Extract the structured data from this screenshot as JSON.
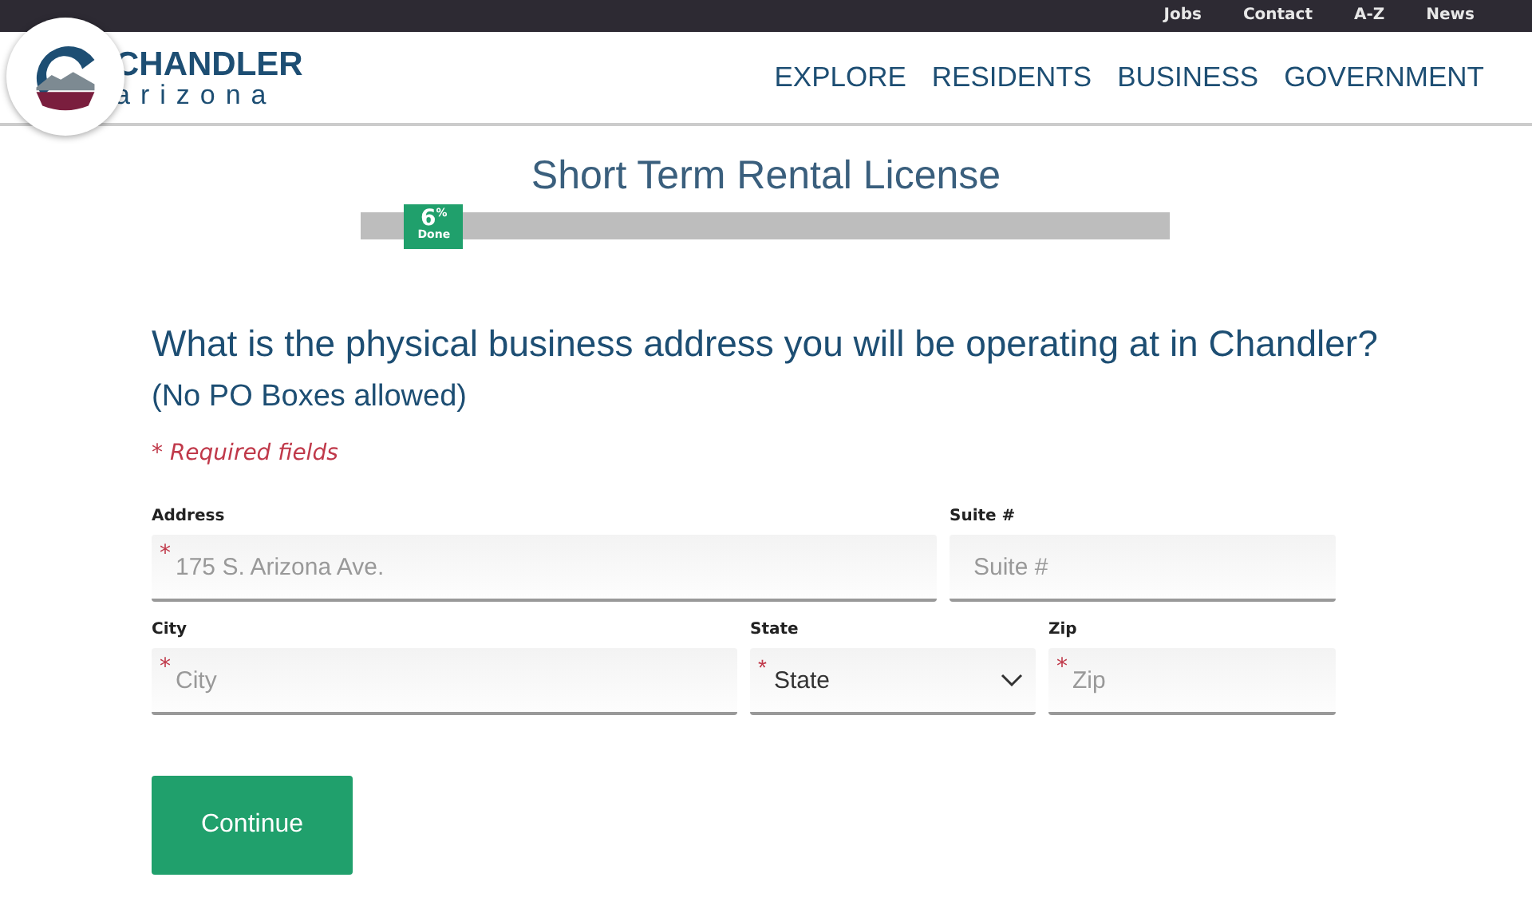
{
  "utility_links": [
    "Jobs",
    "Contact",
    "A-Z",
    "News"
  ],
  "logo": {
    "name": "CHANDLER",
    "subtitle": "arizona"
  },
  "nav": [
    "EXPLORE",
    "RESIDENTS",
    "BUSINESS",
    "GOVERNMENT"
  ],
  "title": "Short Term Rental License",
  "progress": {
    "level": 0.06,
    "value": "6$^{%}$",
    "label": "Done"
  },
  "question": {
    "text": "What is the physical business address you will be operating at in Chandler?",
    "note": "(No PO Boxes allowed)"
  },
  "required_note": "* Required fields",
  "required_mark": "*",
  "rows": [
    [
      {
        "kind": "text",
        "label": "Address",
        "placeholder": "175 S. Arizona Ave.",
        "required": true
      },
      {
        "kind": "text",
        "label": "Suite #",
        "placeholder": "Suite #",
        "required": false
      }
    ],
    [
      {
        "kind": "text",
        "label": "City",
        "placeholder": "City",
        "required": true
      },
      {
        "kind": "select",
        "label": "State",
        "value": "State",
        "required": true
      },
      {
        "kind": "text",
        "label": "Zip",
        "placeholder": "Zip",
        "required": true
      }
    ]
  ],
  "button": "Continue"
}
